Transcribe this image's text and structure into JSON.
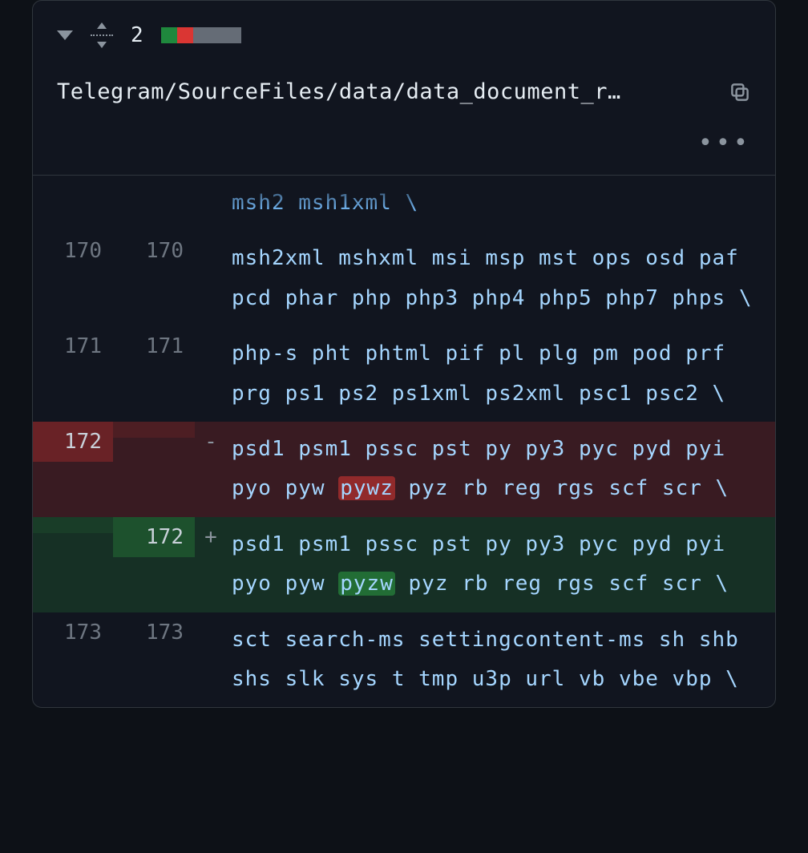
{
  "header": {
    "comment_count": "2",
    "diffstat": [
      "green",
      "red",
      "gray",
      "gray",
      "gray"
    ],
    "filepath": "Telegram/SourceFiles/data/data_document_r…"
  },
  "diff": {
    "rows": [
      {
        "kind": "cut",
        "old": "",
        "new": "",
        "mark": "",
        "text": "msh2 msh1xml \\"
      },
      {
        "kind": "ctx",
        "old": "170",
        "new": "170",
        "mark": "",
        "text": "msh2xml mshxml msi msp mst ops osd paf pcd phar php php3 php4 php5 php7 phps \\"
      },
      {
        "kind": "ctx",
        "old": "171",
        "new": "171",
        "mark": "",
        "text": "php-s pht phtml pif pl plg pm pod prf prg ps1 ps2 ps1xml ps2xml psc1 psc2 \\"
      },
      {
        "kind": "del",
        "old": "172",
        "new": "",
        "mark": "-",
        "pre": "psd1 psm1 pssc pst py py3 pyc pyd pyi pyo pyw ",
        "hl": "pywz",
        "post": " pyz rb reg rgs scf scr \\"
      },
      {
        "kind": "add",
        "old": "",
        "new": "172",
        "mark": "+",
        "pre": "psd1 psm1 pssc pst py py3 pyc pyd pyi pyo pyw ",
        "hl": "pyzw",
        "post": " pyz rb reg rgs scf scr \\"
      },
      {
        "kind": "ctx",
        "old": "173",
        "new": "173",
        "mark": "",
        "text": "sct search-ms settingcontent-ms sh shb shs slk sys t tmp u3p url vb vbe vbp \\"
      }
    ]
  }
}
